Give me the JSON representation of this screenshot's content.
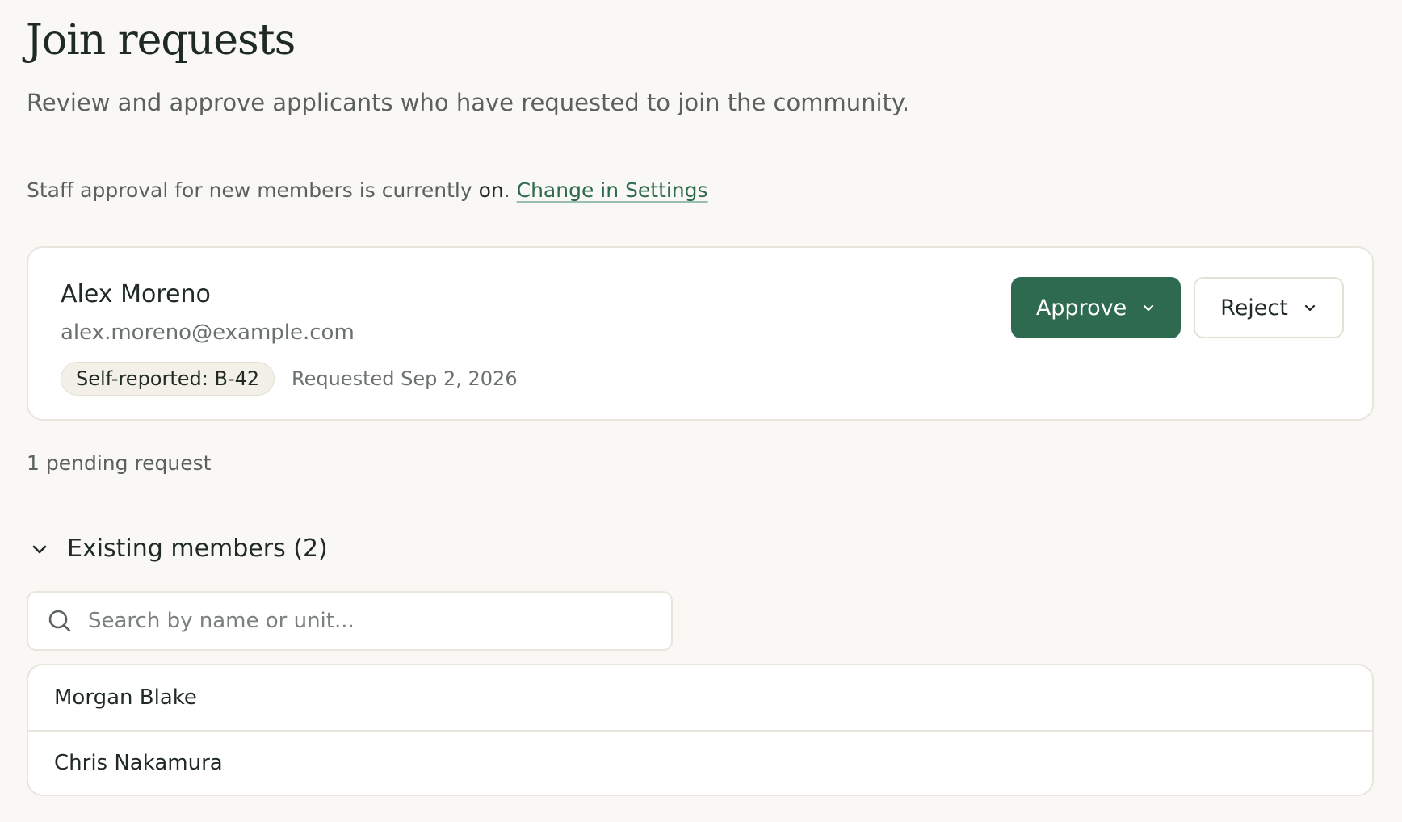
{
  "header": {
    "title": "Join requests",
    "subtitle": "Review and approve applicants who have requested to join the community."
  },
  "approval_notice": {
    "prefix": "Staff approval for new members is currently ",
    "status": "on",
    "separator": ". ",
    "link_label": "Change in Settings"
  },
  "requests": [
    {
      "name": "Alex Moreno",
      "email": "alex.moreno@example.com",
      "unit_badge": "Self-reported: B-42",
      "requested": "Requested Sep 2, 2026",
      "approve_label": "Approve",
      "reject_label": "Reject"
    }
  ],
  "pending_summary": "1 pending request",
  "members_section": {
    "title": "Existing members (2)",
    "expanded": true,
    "search_placeholder": "Search by name or unit...",
    "search_value": "",
    "members": [
      {
        "name": "Morgan Blake"
      },
      {
        "name": "Chris Nakamura"
      }
    ]
  },
  "colors": {
    "background": "#f9f8f4",
    "primary": "#2e6a4f",
    "link": "#2d6a4f",
    "text": "#1f2a24",
    "muted_text": "#5b625d",
    "border": "#e7e5dc",
    "badge_bg": "#f2f0e7"
  },
  "icons": {
    "approve_menu": "chevron-down-icon",
    "reject_menu": "chevron-down-icon",
    "section_toggle": "chevron-down-icon",
    "search": "search-icon"
  }
}
